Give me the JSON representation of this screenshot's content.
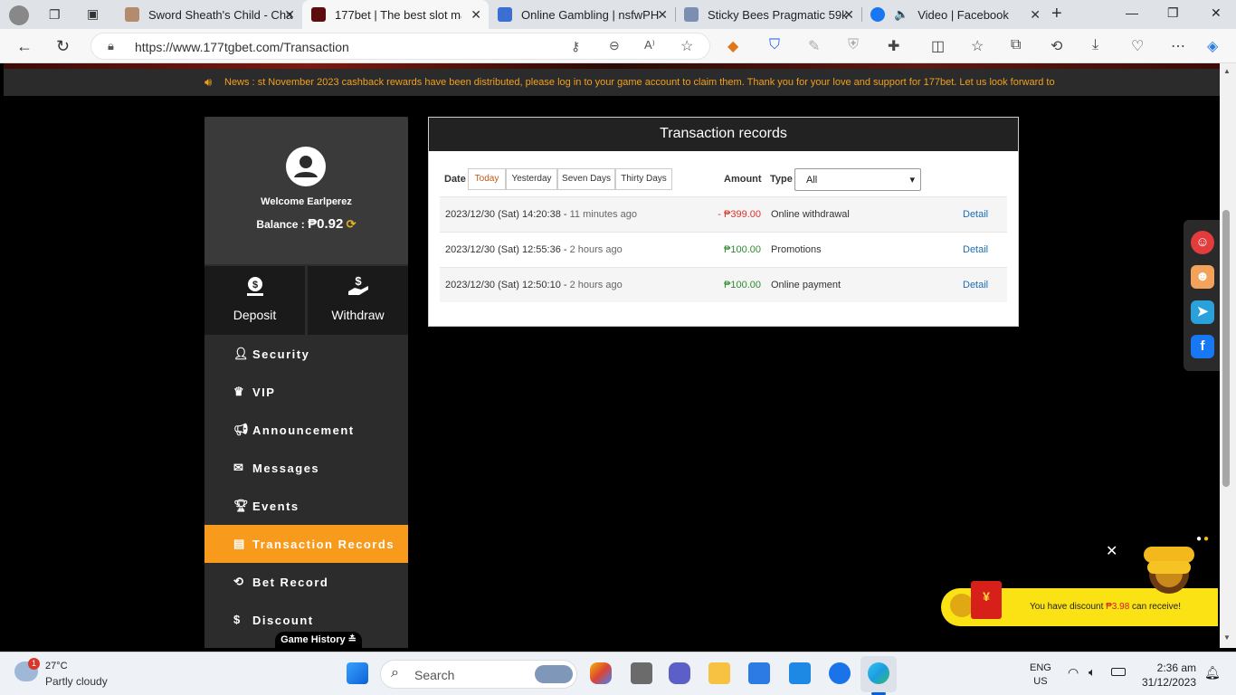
{
  "browser": {
    "tabs": [
      {
        "title": "Sword Sheath's Child - Cha",
        "active": false
      },
      {
        "title": "177bet | The best slot mac",
        "active": true
      },
      {
        "title": "Online Gambling | nsfwPH",
        "active": false
      },
      {
        "title": "Sticky Bees Pragmatic 59k",
        "active": false
      },
      {
        "title": "Video | Facebook",
        "active": false
      }
    ],
    "url": "https://www.177tgbet.com/Transaction"
  },
  "news": {
    "label": "News :",
    "text": "st November 2023 cashback rewards have been distributed, please log in to your game account to claim them. Thank you for your love and support for 177bet. Let us look forward to"
  },
  "profile": {
    "welcome": "Welcome Earlperez",
    "balance_label": "Balance :",
    "balance_value": "₱0.92"
  },
  "actions": {
    "deposit": "Deposit",
    "withdraw": "Withdraw"
  },
  "menu": [
    {
      "label": "Security",
      "icon": "user-lock-icon"
    },
    {
      "label": "VIP",
      "icon": "crown-icon"
    },
    {
      "label": "Announcement",
      "icon": "megaphone-icon"
    },
    {
      "label": "Messages",
      "icon": "envelope-icon"
    },
    {
      "label": "Events",
      "icon": "trophy-icon"
    },
    {
      "label": "Transaction Records",
      "icon": "clipboard-icon"
    },
    {
      "label": "Bet Record",
      "icon": "history-icon"
    },
    {
      "label": "Discount",
      "icon": "dollar-circle-icon"
    }
  ],
  "game_history": "Game History ≛",
  "panel": {
    "title": "Transaction records",
    "date_label": "Date",
    "filters": [
      "Today",
      "Yesterday",
      "Seven Days",
      "Thirty Days"
    ],
    "amount_label": "Amount",
    "type_label": "Type",
    "type_value": "All"
  },
  "records": [
    {
      "datetime": "2023/12/30 (Sat) 14:20:38 -",
      "ago": "11 minutes ago",
      "amount": "- ₱399.00",
      "type": "Online withdrawal",
      "link": "Detail",
      "color": "#d9342b"
    },
    {
      "datetime": "2023/12/30 (Sat) 12:55:36 -",
      "ago": "2 hours ago",
      "amount": "₱100.00",
      "type": "Promotions",
      "link": "Detail",
      "color": "#2e8b2e"
    },
    {
      "datetime": "2023/12/30 (Sat) 12:50:10 -",
      "ago": "2 hours ago",
      "amount": "₱100.00",
      "type": "Online payment",
      "link": "Detail",
      "color": "#2e8b2e"
    }
  ],
  "discount": {
    "pre": "You have discount ",
    "amount": "₱3.98",
    "post": " can receive!"
  },
  "taskbar": {
    "weather_temp": "27°C",
    "weather_desc": "Partly cloudy",
    "weather_badge": "1",
    "search": "Search",
    "lang1": "ENG",
    "lang2": "US",
    "time": "2:36 am",
    "date": "31/12/2023"
  },
  "colors": {
    "accent_orange": "#f89b1d",
    "link_blue": "#1a6fb5",
    "negative_red": "#d9342b",
    "positive_green": "#2e8b2e"
  }
}
